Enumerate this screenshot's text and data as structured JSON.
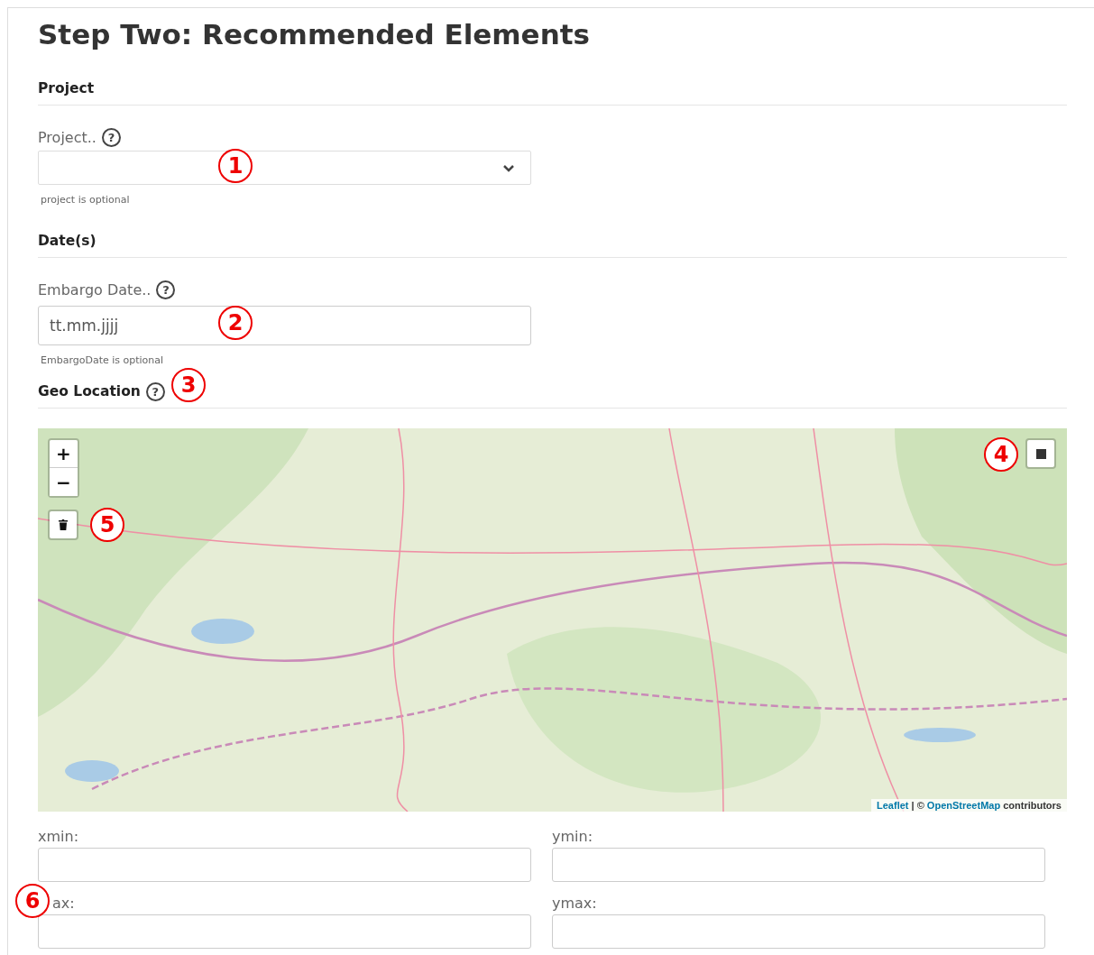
{
  "title": "Step Two: Recommended Elements",
  "project": {
    "heading": "Project",
    "label": "Project..",
    "help": "?",
    "hint": "project is optional",
    "marker": "1"
  },
  "dates": {
    "heading": "Date(s)",
    "label": "Embargo Date..",
    "help": "?",
    "placeholder": "tt.mm.jjjj",
    "hint": "EmbargoDate is optional",
    "marker": "2"
  },
  "geo": {
    "heading": "Geo Location",
    "help": "?",
    "marker": "3"
  },
  "map": {
    "kind": "picture",
    "zoom_in": "+",
    "zoom_out": "−",
    "draw_marker": "4",
    "delete_marker": "5",
    "attribution": [
      {
        "text": "Leaflet",
        "link": true
      },
      {
        "text": " | © ",
        "link": false
      },
      {
        "text": "OpenStreetMap",
        "link": true
      },
      {
        "text": " contributors",
        "link": false
      }
    ]
  },
  "coordinates": {
    "fields": [
      {
        "label": "xmin:"
      },
      {
        "label": "ymin:"
      },
      {
        "label": "ax:",
        "marker": "6"
      },
      {
        "label": "ymax:"
      }
    ]
  }
}
